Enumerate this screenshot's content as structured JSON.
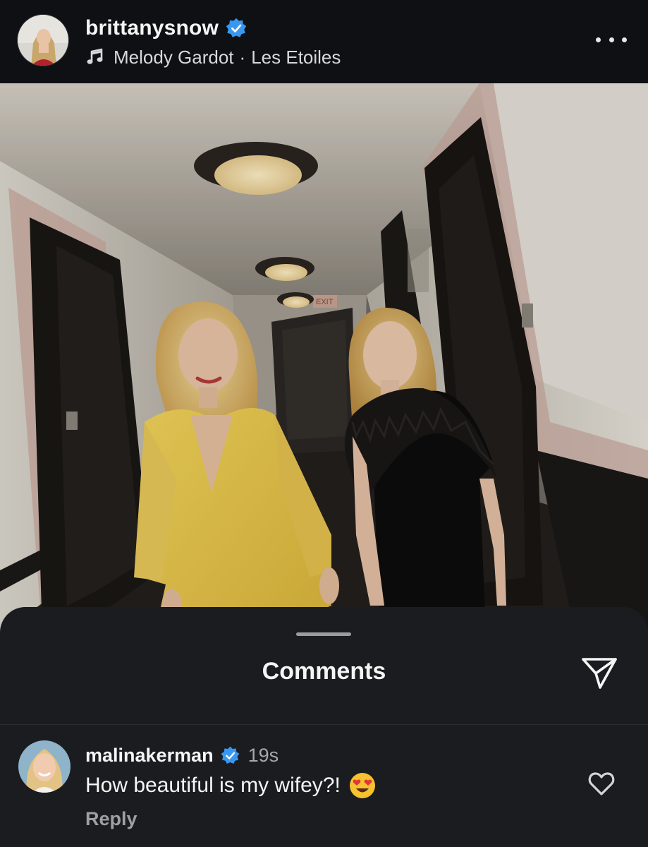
{
  "post": {
    "username": "brittanysnow",
    "verified": true,
    "audio_artist": "Melody Gardot",
    "audio_separator": "·",
    "audio_track": "Les Etoiles"
  },
  "icons": {
    "verified": "verified-badge-icon",
    "music": "music-note-icon",
    "more": "more-options-icon",
    "share": "send-icon",
    "like": "heart-outline-icon"
  },
  "comments_sheet": {
    "title": "Comments"
  },
  "comments": [
    {
      "username": "malinakerman",
      "verified": true,
      "time": "19s",
      "text": "How beautiful is my wifey?!",
      "emoji": "😍",
      "reply_label": "Reply"
    }
  ],
  "colors": {
    "background": "#0f1014",
    "sheet": "#1a1c20",
    "verified_blue": "#3897f0",
    "text_primary": "#f5f5f5",
    "text_secondary": "#a7a8ad"
  }
}
